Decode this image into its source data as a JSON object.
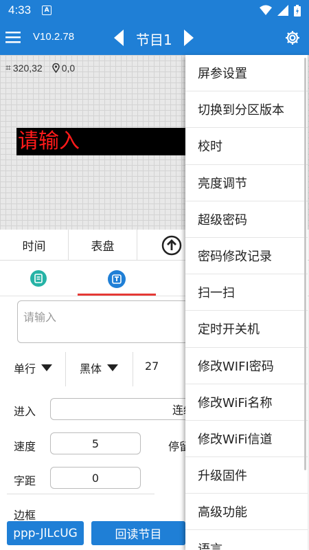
{
  "status_bar": {
    "time": "4:33",
    "notification_letter": "A"
  },
  "app_bar": {
    "version": "V10.2.78",
    "title": "节目1"
  },
  "canvas": {
    "size_readout": "320,32",
    "position_readout": "0,0",
    "led_text": "请输入"
  },
  "function_tabs": [
    "时间",
    "表盘"
  ],
  "text_input": {
    "placeholder": "请输入"
  },
  "selectors": {
    "line_mode": "单行",
    "font": "黑体",
    "font_size": "27"
  },
  "form": {
    "enter_label": "进入",
    "enter_value": "连续左",
    "speed_label": "速度",
    "speed_value": "5",
    "stay_label": "停留",
    "spacing_label": "字距",
    "spacing_value": "0",
    "border_label": "边框"
  },
  "bottom_buttons": {
    "device": "ppp-JlLcUG",
    "read_back": "回读节目"
  },
  "menu": {
    "items": [
      "屏参设置",
      "切换到分区版本",
      "校时",
      "亮度调节",
      "超级密码",
      "密码修改记录",
      "扫一扫",
      "定时开关机",
      "修改WIFI密码",
      "修改WiFi名称",
      "修改WiFi信道",
      "升级固件",
      "高级功能",
      "语言"
    ]
  },
  "colors": {
    "primary": "#1f7fd6",
    "accent": "#e53935",
    "led_text": "#ff1a1a",
    "tab_icon_teal": "#26b3a6"
  }
}
